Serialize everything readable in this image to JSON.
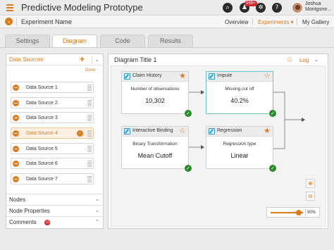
{
  "header": {
    "app_title": "Predictive Modeling Prototype",
    "notification_count": "999+",
    "user_name_line1": "Joshua",
    "user_name_line2": "Montgomr..."
  },
  "subheader": {
    "experiment_name": "Experiment Name",
    "nav": [
      {
        "label": "Overview"
      },
      {
        "label": "Experiments ▾"
      },
      {
        "label": "My Gallery"
      }
    ]
  },
  "tabs": [
    {
      "label": "Settings"
    },
    {
      "label": "Diagram"
    },
    {
      "label": "Code"
    },
    {
      "label": "Results"
    }
  ],
  "left_panel": {
    "title": "Data Sources",
    "done_label": "Done",
    "data_sources": [
      {
        "label": "Data Source 1"
      },
      {
        "label": "Data Source 2"
      },
      {
        "label": "Data Source 3"
      },
      {
        "label": "Data Source 4"
      },
      {
        "label": "Data Source 5"
      },
      {
        "label": "Data Source 6"
      },
      {
        "label": "Data Source 7"
      }
    ],
    "sections": [
      {
        "label": "Nodes"
      },
      {
        "label": "Node Properties"
      },
      {
        "label": "Comments"
      }
    ],
    "comments_count": "10"
  },
  "diagram": {
    "title": "Diagram Title 1",
    "log_label": "Log",
    "nodes": [
      {
        "title": "Claim History",
        "line1": "Number of observations",
        "line2": "10,302",
        "starred": true
      },
      {
        "title": "Impute",
        "line1": "Missing cut off",
        "line2": "40.2%",
        "starred": false
      },
      {
        "title": "Interactive Binding",
        "line1": "Binary Transformation",
        "line2": "Mean Cutoff",
        "starred": false
      },
      {
        "title": "Regression",
        "line1": "Regression type",
        "line2": "Linear",
        "starred": true
      }
    ],
    "zoom_percent": "90%"
  },
  "colors": {
    "accent": "#e07a1f",
    "success": "#2a8a2a",
    "badge": "#d7262b",
    "edit_icon": "#2a9fd6"
  }
}
